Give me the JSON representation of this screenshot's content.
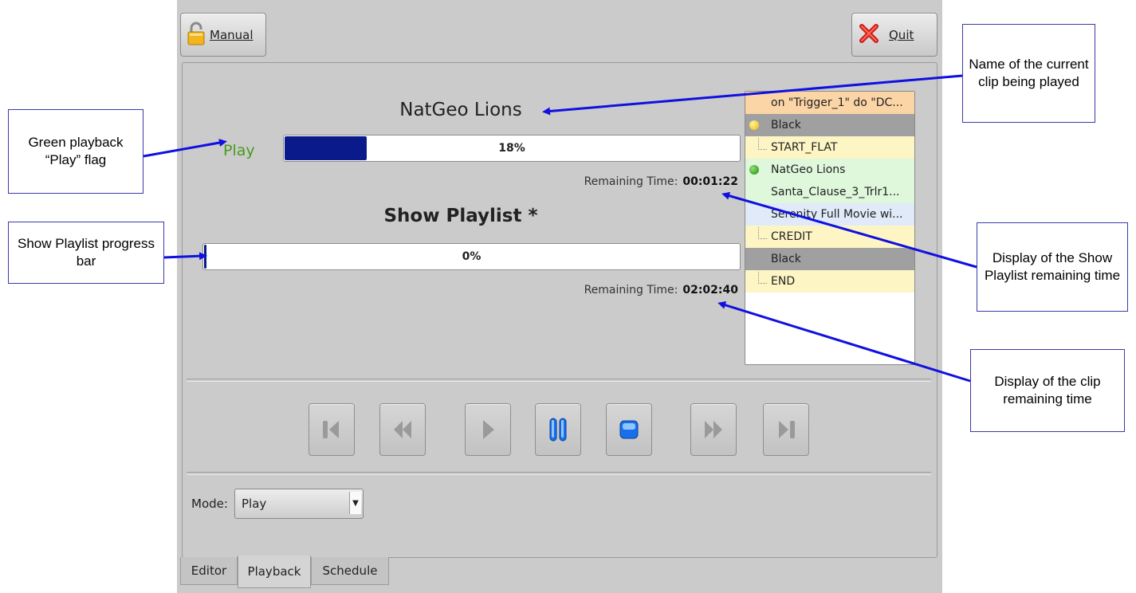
{
  "toolbar": {
    "manual_label": "Manual",
    "quit_label": "Quit"
  },
  "clip": {
    "name": "NatGeo Lions",
    "state": "Play",
    "progress_percent": 18,
    "progress_text": "18%",
    "remaining_label": "Remaining Time:",
    "remaining_value": "00:01:22"
  },
  "playlist": {
    "name": "Show Playlist *",
    "progress_percent": 0,
    "progress_text": "0%",
    "remaining_label": "Remaining Time:",
    "remaining_value": "02:02:40",
    "items": [
      {
        "label": "on \"Trigger_1\" do \"DC...",
        "bg": "#fbd5a6",
        "marker": "none"
      },
      {
        "label": "Black",
        "bg": "#a0a0a0",
        "marker": "yellow-dot"
      },
      {
        "label": "START_FLAT",
        "bg": "#fdf5c4",
        "marker": "tree"
      },
      {
        "label": "NatGeo Lions",
        "bg": "#dff8dc",
        "marker": "green-dot"
      },
      {
        "label": "Santa_Clause_3_Trlr1...",
        "bg": "#dff8dc",
        "marker": "none"
      },
      {
        "label": "Serenity Full Movie wi...",
        "bg": "#e0eaf8",
        "marker": "none"
      },
      {
        "label": "CREDIT",
        "bg": "#fdf5c4",
        "marker": "tree"
      },
      {
        "label": "Black",
        "bg": "#a0a0a0",
        "marker": "none"
      },
      {
        "label": "END",
        "bg": "#fdf5c4",
        "marker": "tree"
      }
    ]
  },
  "transport": {
    "buttons": [
      "skip-first",
      "rewind",
      "play",
      "pause",
      "stop",
      "fast-forward",
      "skip-last"
    ],
    "active": [
      "pause",
      "stop"
    ]
  },
  "mode": {
    "label": "Mode:",
    "value": "Play"
  },
  "tabs": [
    {
      "label": "Editor",
      "active": false
    },
    {
      "label": "Playback",
      "active": true
    },
    {
      "label": "Schedule",
      "active": false
    }
  ],
  "annotations": {
    "current_clip": "Name of the current clip being played",
    "play_flag": "Green playback “Play” flag",
    "playlist_bar": "Show Playlist progress bar",
    "playlist_remaining": "Display of the Show Playlist remaining time",
    "clip_remaining": "Display of the clip remaining time"
  },
  "colors": {
    "window_bg": "#cbcbcb",
    "progress_fill": "#0a1a8a",
    "play_green": "#4a9a1a",
    "arrow_blue": "#1010e0"
  }
}
